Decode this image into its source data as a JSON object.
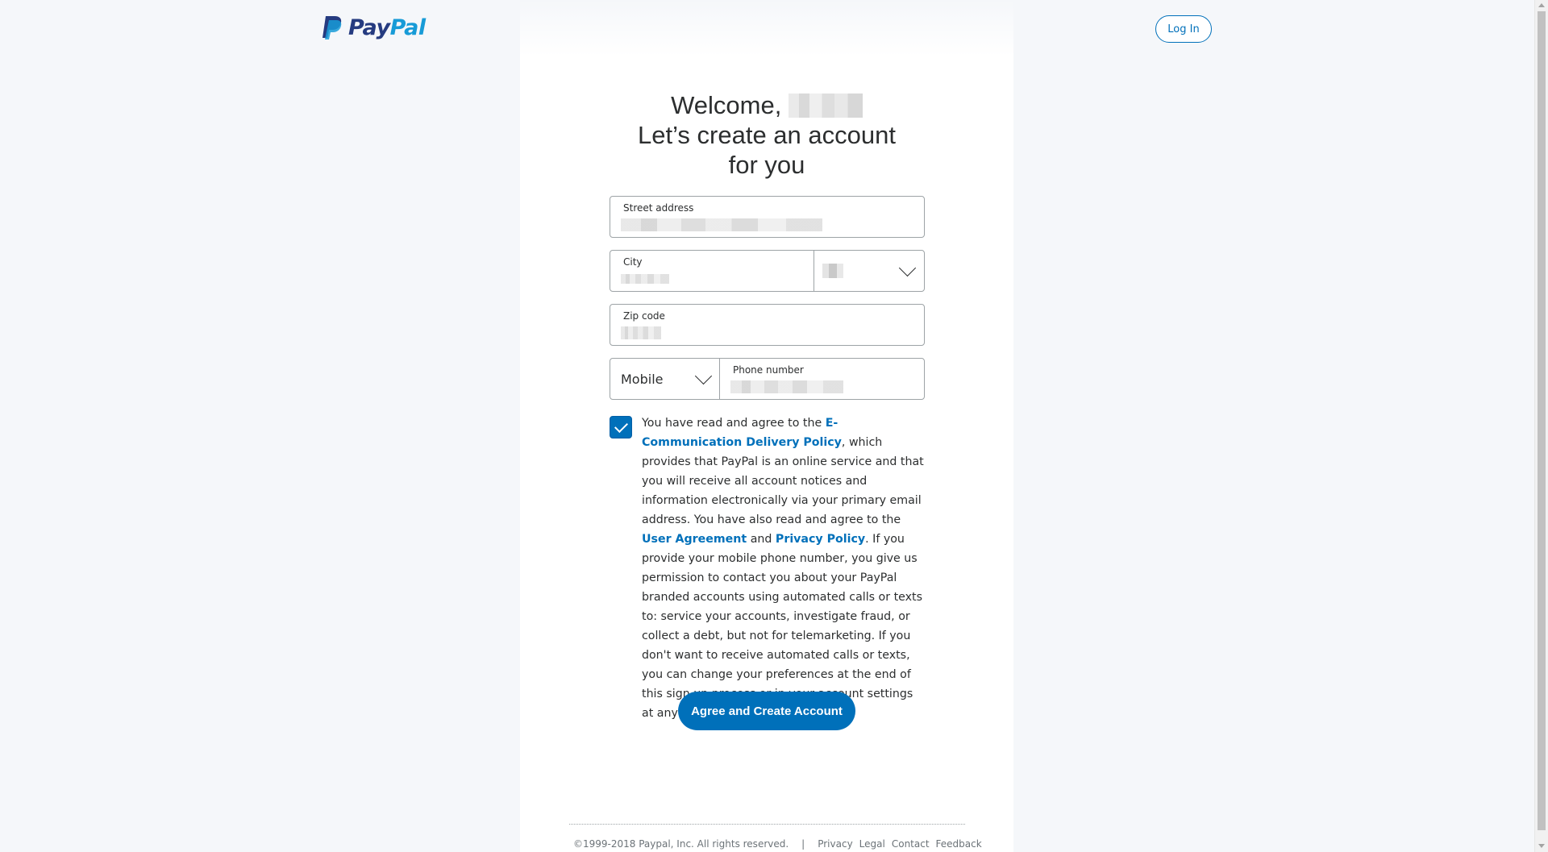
{
  "header": {
    "logo_pay": "Pay",
    "logo_pal": "Pal",
    "login_label": "Log In"
  },
  "heading": {
    "welcome": "Welcome,",
    "subtitle": "Let’s create an account for you"
  },
  "form": {
    "street_label": "Street address",
    "city_label": "City",
    "zip_label": "Zip code",
    "phone_type_label": "Mobile",
    "phone_label": "Phone number"
  },
  "consent": {
    "checked": true,
    "text_1": "You have read and agree to the ",
    "link_ecomm": "E-Communication Delivery Policy",
    "text_2": ", which provides that PayPal is an online service and that you will receive all account notices and information electronically via your primary email address. You have also read and agree to the ",
    "link_user_agreement": "User Agreement",
    "text_3": " and ",
    "link_privacy": "Privacy Policy",
    "text_4": ". If you provide your mobile phone number, you give us permission to contact you about your PayPal branded accounts using automated calls or texts to: service your accounts, investigate fraud, or collect a debt, but not for telemarketing. If you don't want to receive automated calls or texts, you can change your preferences at the end of this sign up process or in your account settings at any time."
  },
  "submit_label": "Agree and Create Account",
  "footer": {
    "copyright": "©1999-2018 Paypal, Inc. All rights reserved.",
    "separator": "|",
    "links": [
      "Privacy",
      "Legal",
      "Contact",
      "Feedback"
    ]
  },
  "colors": {
    "brand_blue": "#0070ba",
    "logo_dark": "#253b80",
    "logo_light": "#179bd7"
  }
}
